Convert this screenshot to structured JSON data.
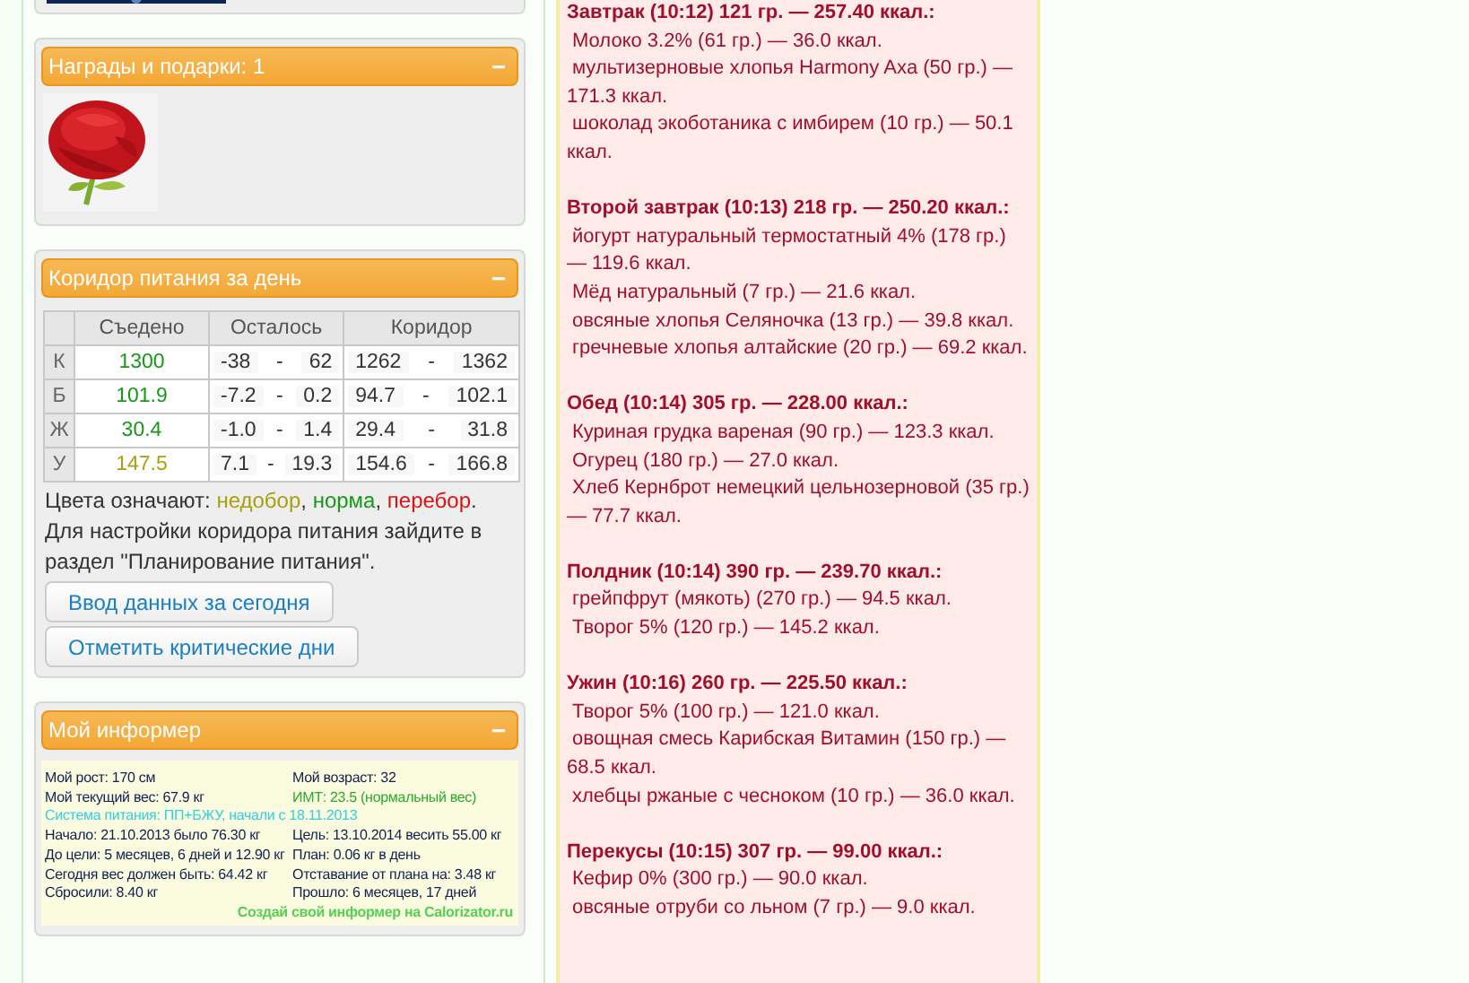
{
  "awards": {
    "title": "Награды и подарки: 1",
    "collapse": "−"
  },
  "corridor": {
    "title": "Коридор питания за день",
    "collapse": "−",
    "columns": [
      "Съедено",
      "Осталось",
      "Коридор"
    ],
    "rows": [
      {
        "label": "К",
        "eaten": "1300",
        "color": "#189818",
        "left_from": "-38",
        "left_to": "62",
        "range_from": "1262",
        "range_to": "1362"
      },
      {
        "label": "Б",
        "eaten": "101.9",
        "color": "#189818",
        "left_from": "-7.2",
        "left_to": "0.2",
        "range_from": "94.7",
        "range_to": "102.1"
      },
      {
        "label": "Ж",
        "eaten": "30.4",
        "color": "#189818",
        "left_from": "-1.0",
        "left_to": "1.4",
        "range_from": "29.4",
        "range_to": "31.8"
      },
      {
        "label": "У",
        "eaten": "147.5",
        "color": "#a8a010",
        "left_from": "7.1",
        "left_to": "19.3",
        "range_from": "154.6",
        "range_to": "166.8"
      }
    ],
    "dash": "-",
    "legend": {
      "prefix": "Цвета означают:",
      "items": [
        {
          "text": "недобор",
          "color": "#a8a010",
          "after": ","
        },
        {
          "text": "норма",
          "color": "#189818",
          "after": ","
        },
        {
          "text": "перебор",
          "color": "#e01010",
          "after": "."
        }
      ]
    },
    "note": "Для настройки коридора питания зайдите в раздел \"Планирование питания\".",
    "buttons": [
      "Ввод данных за сегодня",
      "Отметить критические дни"
    ]
  },
  "informer": {
    "title": "Мой информер",
    "collapse": "−",
    "lines": [
      {
        "left": "Мой рост: 170 см",
        "right": "Мой возраст: 32",
        "color": "#102050"
      },
      {
        "left": "Мой текущий вес: 67.9 кг",
        "right": "ИМТ: 23.5 (нормальный вес)",
        "color": "#2aaa2a"
      },
      {
        "full": "Система питания: ПП+БЖУ, начали с 18.11.2013"
      },
      {
        "left": "Начало: 21.10.2013 было 76.30 кг",
        "right": "Цель: 13.10.2014 весить 55.00 кг",
        "color": "#102050"
      },
      {
        "left": "До цели: 5 месяцев, 6 дней и 12.90 кг",
        "right": "План: 0.06 кг в день",
        "color": "#102050"
      },
      {
        "left": "Сегодня вес должен быть: 64.42 кг",
        "right": "Отставание от плана на: 3.48 кг",
        "color": "#102050"
      },
      {
        "left": "Сбросили: 8.40 кг",
        "right": "Прошло: 6 месяцев, 17 дней",
        "color": "#102050"
      }
    ],
    "footer": "Создай свой информер на Calorizator.ru"
  },
  "meals": [
    {
      "header": "Завтрак (10:12) 121 гр. — 257.40 ккал.:",
      "items": [
        "Молоко 3.2% (61 гр.) — 36.0 ккал.",
        "мультизерновые хлопья Harmony Axa (50 гр.) — 171.3 ккал.",
        "шоколад экоботаника с имбирем (10 гр.) — 50.1 ккал."
      ]
    },
    {
      "header": "Второй завтрак (10:13) 218 гр. — 250.20 ккал.:",
      "items": [
        "йогурт натуральный термостатный 4% (178 гр.) — 119.6 ккал.",
        "Мёд натуральный (7 гр.) — 21.6 ккал.",
        "овсяные хлопья Селяночка (13 гр.) — 39.8 ккал.",
        "гречневые хлопья алтайские (20 гр.) — 69.2 ккал."
      ]
    },
    {
      "header": "Обед (10:14) 305 гр. — 228.00 ккал.:",
      "items": [
        "Куриная грудка вареная (90 гр.) — 123.3 ккал.",
        "Огурец (180 гр.) — 27.0 ккал.",
        "Хлеб Кернброт немецкий цельнозерновой (35 гр.) — 77.7 ккал."
      ]
    },
    {
      "header": "Полдник (10:14) 390 гр. — 239.70 ккал.:",
      "items": [
        "грейпфрут (мякоть) (270 гр.) — 94.5 ккал.",
        "Творог 5% (120 гр.) — 145.2 ккал."
      ]
    },
    {
      "header": "Ужин (10:16) 260 гр. — 225.50 ккал.:",
      "items": [
        "Творог 5% (100 гр.) — 121.0 ккал.",
        "овощная смесь Карибская Витамин (150 гр.) — 68.5 ккал.",
        "хлебцы ржаные с чесноком (10 гр.) — 36.0 ккал."
      ]
    },
    {
      "header": "Перекусы (10:15) 307 гр. — 99.00 ккал.:",
      "items": [
        "Кефир 0% (300 гр.) — 90.0 ккал.",
        "овсяные отруби со льном (7 гр.) — 9.0 ккал."
      ]
    }
  ]
}
